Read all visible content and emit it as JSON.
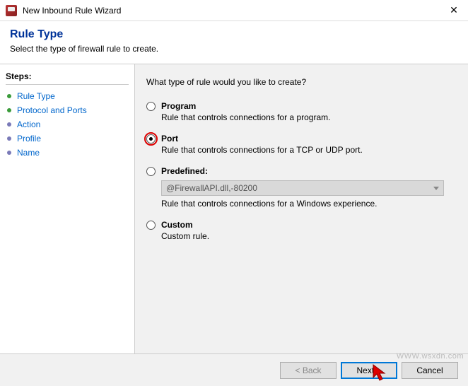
{
  "window": {
    "title": "New Inbound Rule Wizard",
    "close_glyph": "✕"
  },
  "header": {
    "title": "Rule Type",
    "subtitle": "Select the type of firewall rule to create."
  },
  "sidebar": {
    "title": "Steps:",
    "items": [
      {
        "label": "Rule Type"
      },
      {
        "label": "Protocol and Ports"
      },
      {
        "label": "Action"
      },
      {
        "label": "Profile"
      },
      {
        "label": "Name"
      }
    ]
  },
  "main": {
    "prompt": "What type of rule would you like to create?",
    "options": {
      "program": {
        "label": "Program",
        "desc": "Rule that controls connections for a program."
      },
      "port": {
        "label": "Port",
        "desc": "Rule that controls connections for a TCP or UDP port."
      },
      "predefined": {
        "label": "Predefined:",
        "select_value": "@FirewallAPI.dll,-80200",
        "desc": "Rule that controls connections for a Windows experience."
      },
      "custom": {
        "label": "Custom",
        "desc": "Custom rule."
      }
    }
  },
  "footer": {
    "back": "< Back",
    "next": "Next >",
    "cancel": "Cancel"
  },
  "watermark": "WWW.wsxdn.com"
}
